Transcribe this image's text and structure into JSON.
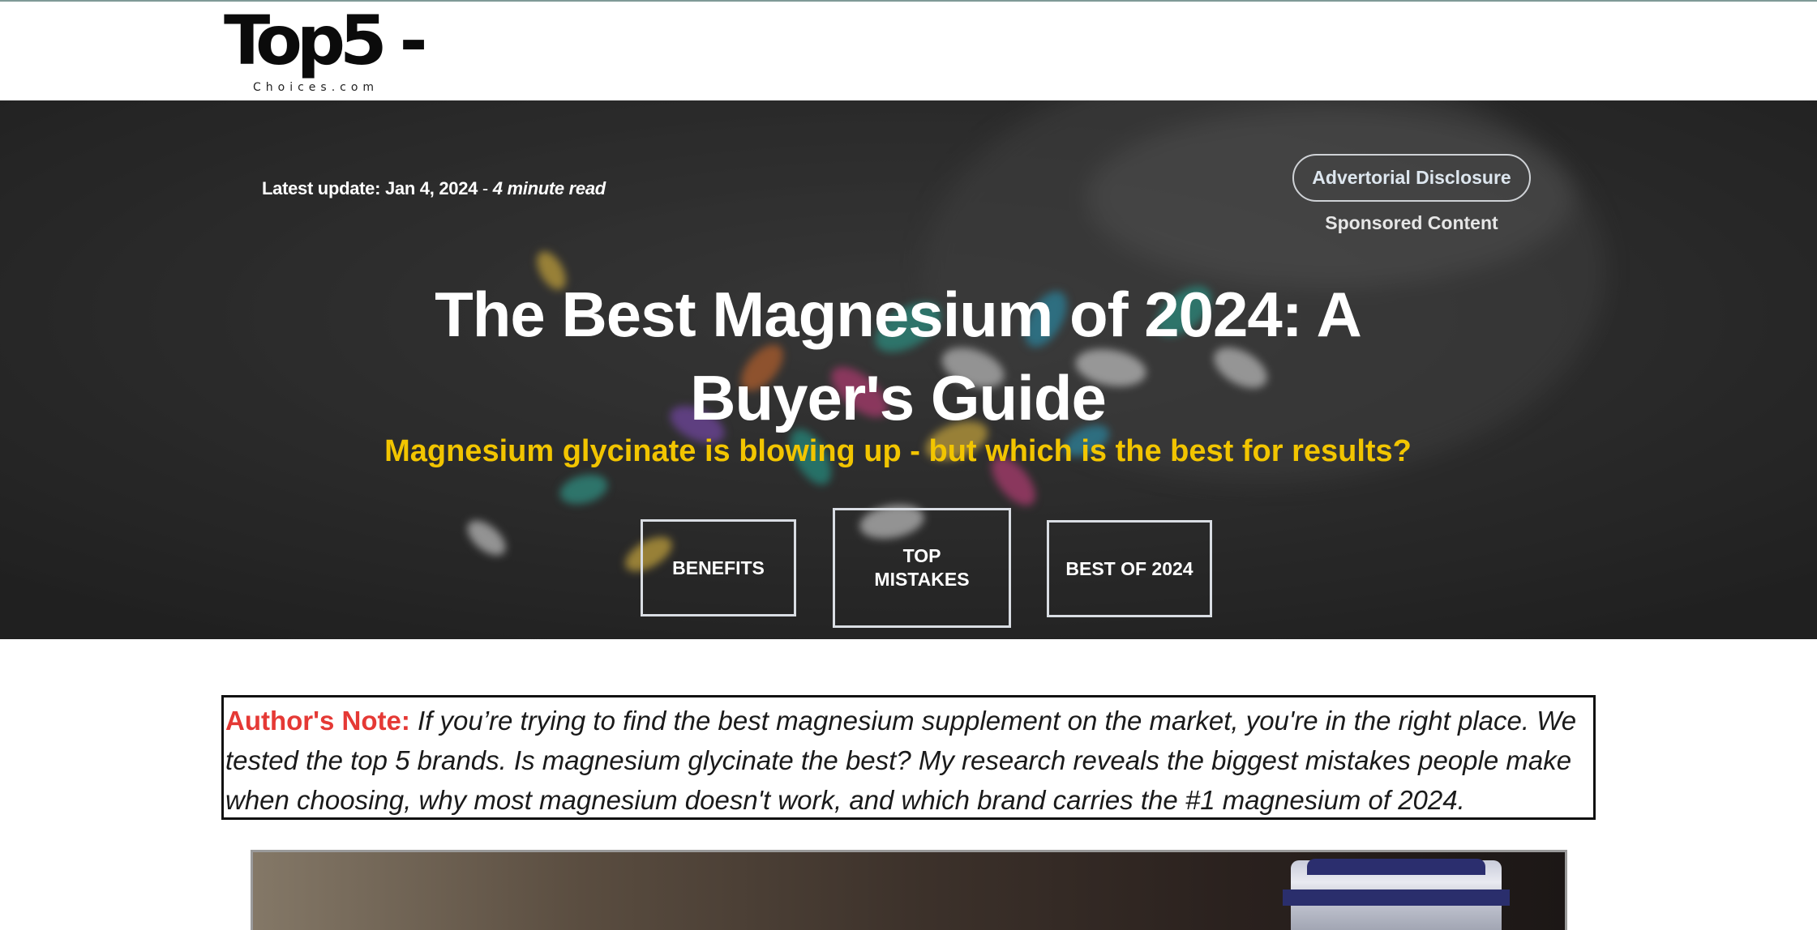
{
  "header": {
    "logo_main": "Top5 -",
    "logo_sub": "Choices.com"
  },
  "hero": {
    "update_label": "Latest update: Jan 4, 2024",
    "update_separator": " - ",
    "read_time": "4 minute read",
    "disclosure_button": "Advertorial Disclosure",
    "sponsored_label": "Sponsored Content",
    "title": "The Best Magnesium of 2024: A Buyer's Guide",
    "subtitle": "Magnesium glycinate is blowing up - but which is the best for results?",
    "nav": [
      {
        "label": "BENEFITS"
      },
      {
        "label": "TOP MISTAKES"
      },
      {
        "label": "BEST OF 2024"
      }
    ]
  },
  "author_note": {
    "label": "Author's Note:",
    "text": "If you’re trying to find the best magnesium supplement on the market, you're in the right place. We tested the top 5 brands. Is magnesium glycinate the best? My research reveals the biggest mistakes people make when choosing, why most magnesium doesn't work, and which brand carries the #1 magnesium of 2024."
  },
  "colors": {
    "accent_yellow": "#f2c500",
    "note_label_red": "#e53935",
    "hero_dark": "#2b2b2b"
  }
}
